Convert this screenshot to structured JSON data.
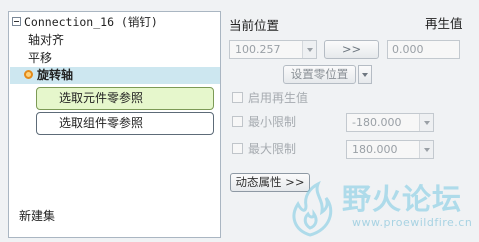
{
  "tree": {
    "root_label": "Connection_16 (销钉)",
    "items": [
      {
        "label": "轴对齐"
      },
      {
        "label": "平移"
      },
      {
        "label": "旋转轴",
        "selected": true
      }
    ],
    "component_ref_label": "选取元件零参照",
    "assembly_ref_label": "选取组件零参照",
    "new_set_label": "新建集"
  },
  "panel": {
    "current_position_label": "当前位置",
    "regen_value_label": "再生值",
    "current_position_value": "100.257",
    "transfer_label": ">>",
    "regen_value": "0.000",
    "set_zero_label": "设置零位置",
    "enable_regen_label": "启用再生值",
    "min_limit_label": "最小限制",
    "min_limit_value": "-180.000",
    "max_limit_label": "最大限制",
    "max_limit_value": "180.000",
    "dynamic_props_label": "动态属性 >>"
  },
  "watermark": {
    "text": "野火论坛",
    "url": "www.proewildfire.cn"
  },
  "colors": {
    "selection": "#cde7f0",
    "active_ref_bg": "#e6f7cc",
    "status_dot": "#e38a1a",
    "watermark": "#78c8e1"
  }
}
